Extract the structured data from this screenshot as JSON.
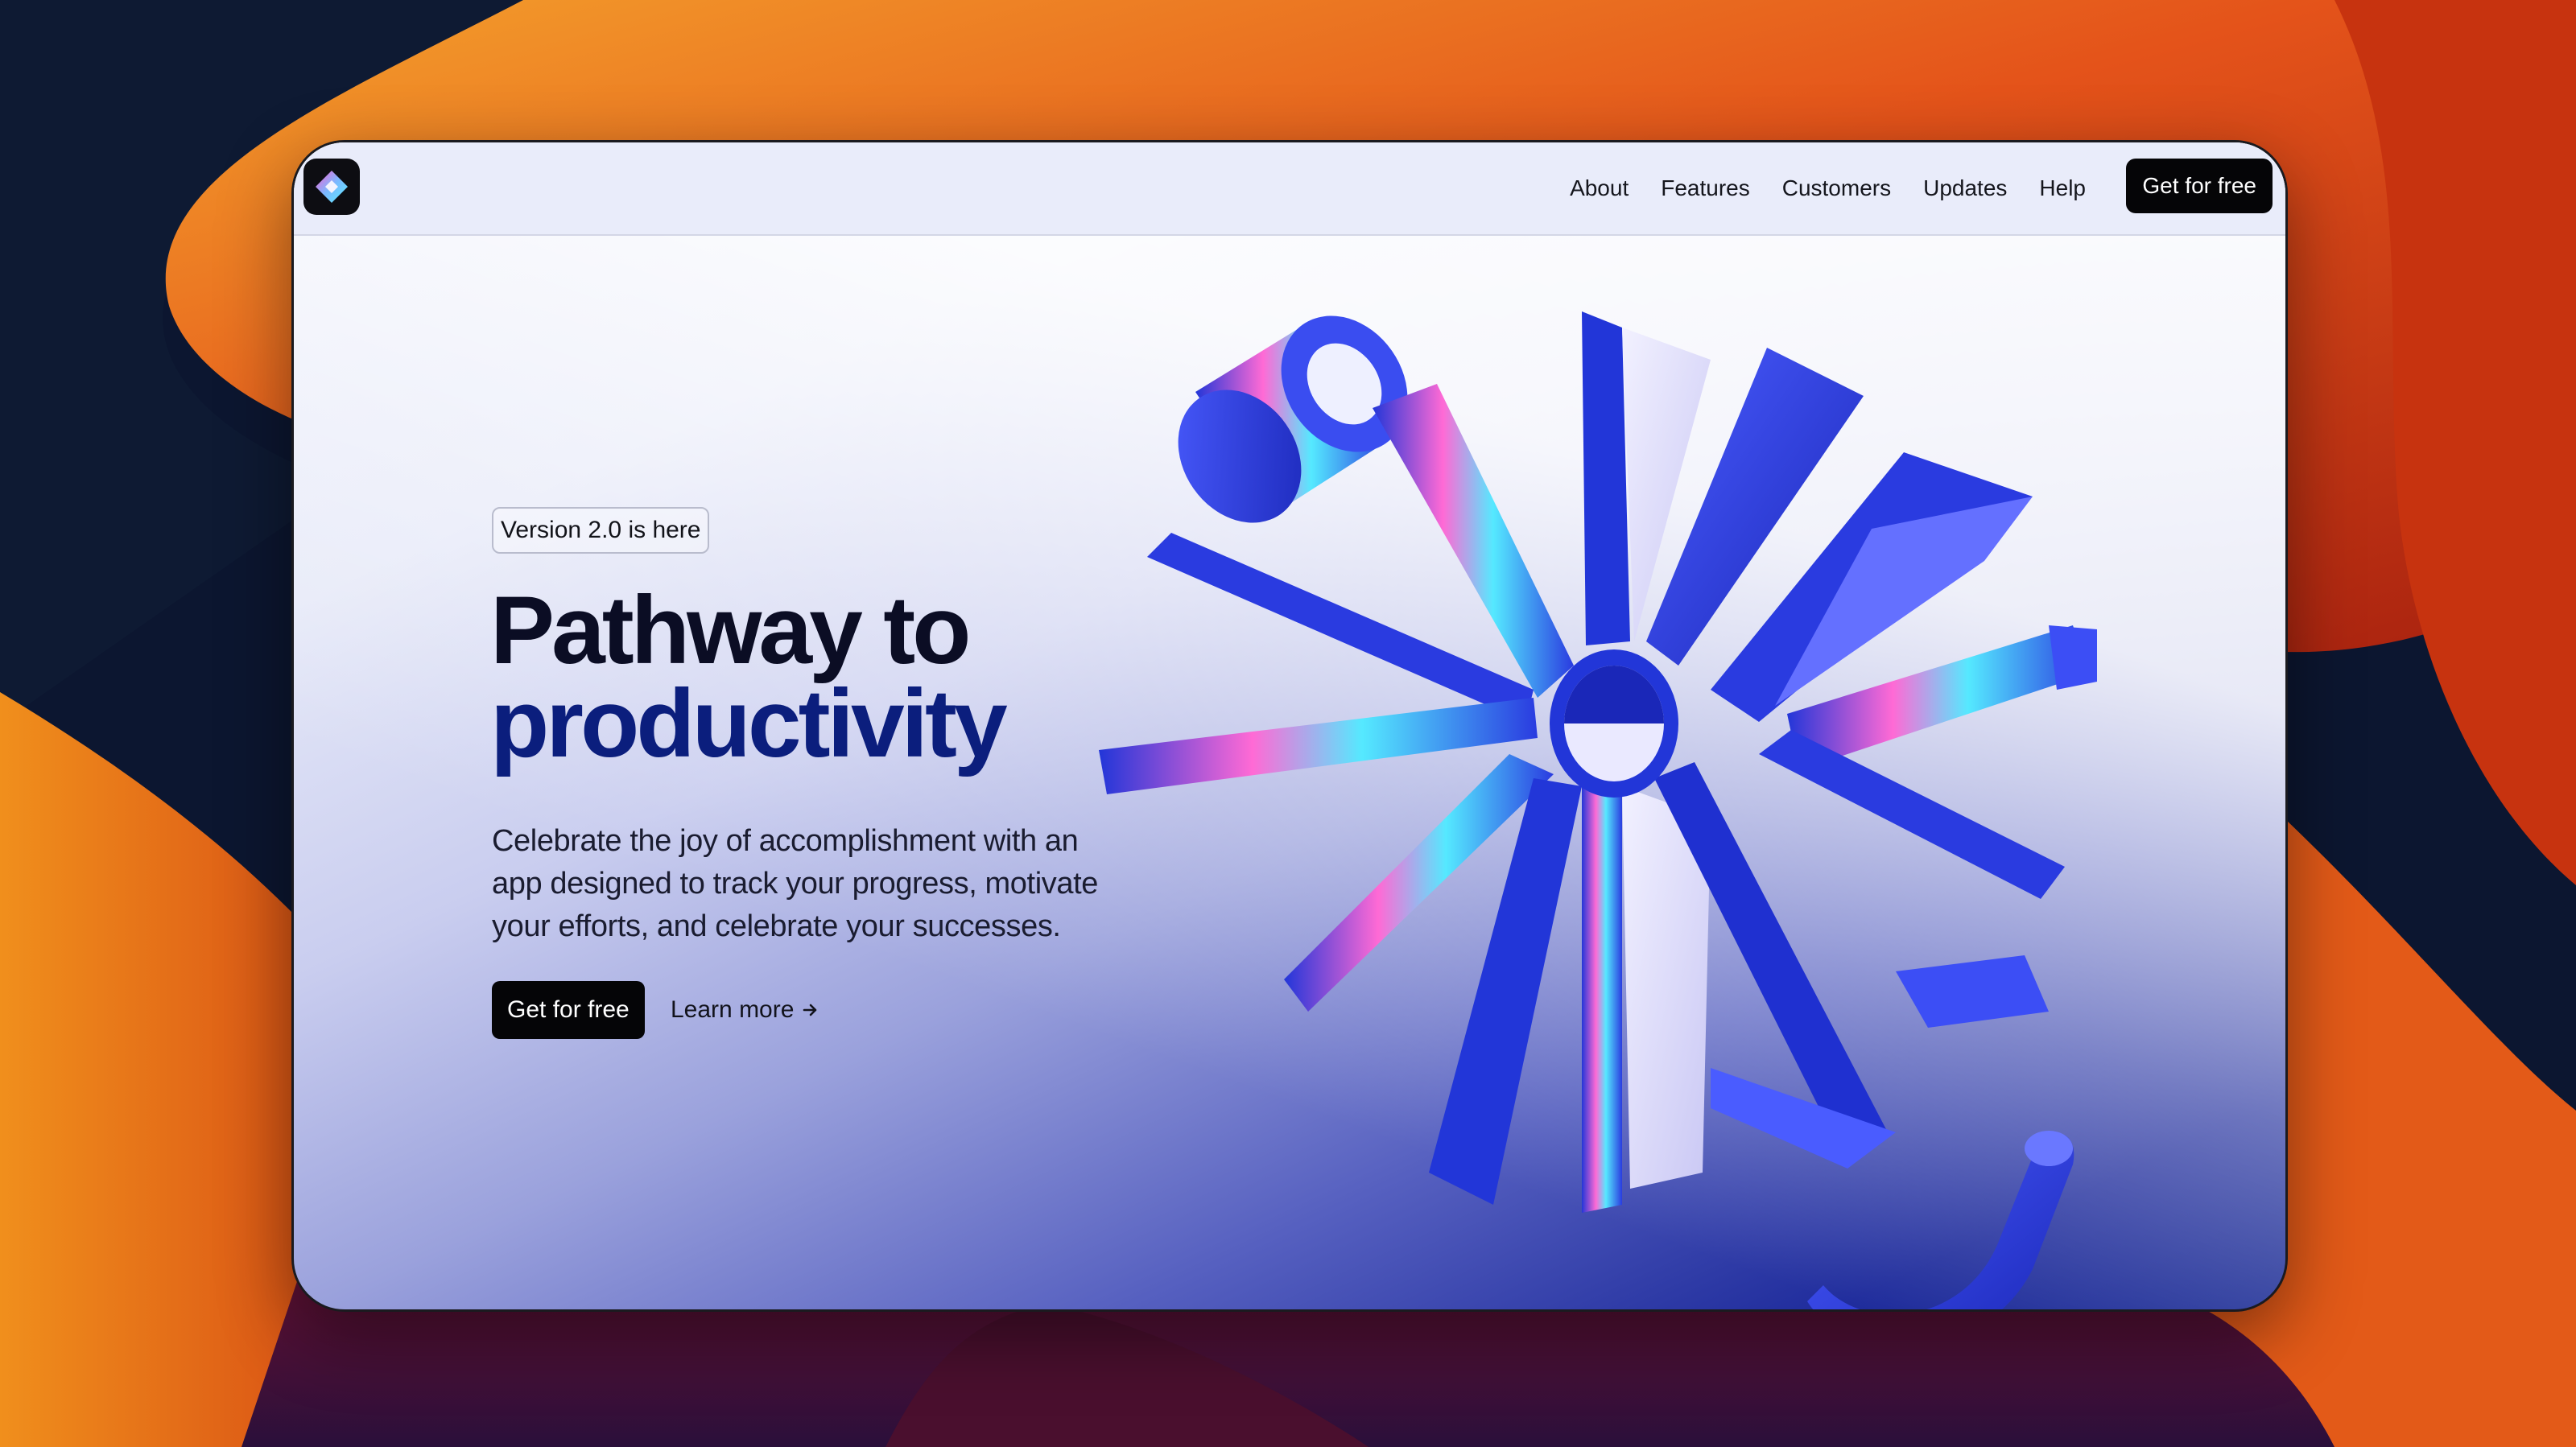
{
  "nav": {
    "links": [
      "About",
      "Features",
      "Customers",
      "Updates",
      "Help"
    ],
    "cta_label": "Get for free"
  },
  "hero": {
    "badge": "Version 2.0 is here",
    "headline_line1": "Pathway to",
    "headline_line2": "productivity",
    "subtext": "Celebrate the joy of accomplishment with an app designed to track your progress, motivate your efforts, and celebrate your successes.",
    "primary_button": "Get for free",
    "secondary_button": "Learn more",
    "secondary_icon": "arrow-right-icon"
  },
  "icons": {
    "logo": "diamond-logo-icon"
  },
  "colors": {
    "headline_dark": "#0b0d24",
    "headline_accent": "#0b1e7d",
    "button_bg": "#050507",
    "art_blue": "#2a3be0"
  }
}
